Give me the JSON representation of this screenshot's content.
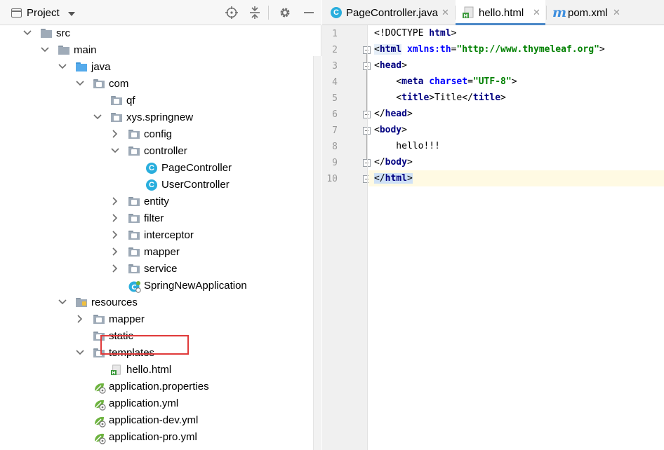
{
  "project_panel": {
    "title": "Project",
    "tree": [
      {
        "label": "src",
        "kind": "folder",
        "depth": 0,
        "state": "expanded"
      },
      {
        "label": "main",
        "kind": "folder",
        "depth": 1,
        "state": "expanded"
      },
      {
        "label": "java",
        "kind": "source-folder",
        "depth": 2,
        "state": "expanded"
      },
      {
        "label": "com",
        "kind": "package",
        "depth": 3,
        "state": "expanded"
      },
      {
        "label": "qf",
        "kind": "package",
        "depth": 4,
        "state": "none"
      },
      {
        "label": "xys.springnew",
        "kind": "package",
        "depth": 4,
        "state": "expanded"
      },
      {
        "label": "config",
        "kind": "package",
        "depth": 5,
        "state": "collapsed"
      },
      {
        "label": "controller",
        "kind": "package",
        "depth": 5,
        "state": "expanded"
      },
      {
        "label": "PageController",
        "kind": "class",
        "depth": 6,
        "state": "none"
      },
      {
        "label": "UserController",
        "kind": "class",
        "depth": 6,
        "state": "none"
      },
      {
        "label": "entity",
        "kind": "package",
        "depth": 5,
        "state": "collapsed"
      },
      {
        "label": "filter",
        "kind": "package",
        "depth": 5,
        "state": "collapsed"
      },
      {
        "label": "interceptor",
        "kind": "package",
        "depth": 5,
        "state": "collapsed"
      },
      {
        "label": "mapper",
        "kind": "package",
        "depth": 5,
        "state": "collapsed"
      },
      {
        "label": "service",
        "kind": "package",
        "depth": 5,
        "state": "collapsed"
      },
      {
        "label": "SpringNewApplication",
        "kind": "spring-class",
        "depth": 5,
        "state": "none"
      },
      {
        "label": "resources",
        "kind": "resource-folder",
        "depth": 2,
        "state": "expanded"
      },
      {
        "label": "mapper",
        "kind": "package",
        "depth": 3,
        "state": "collapsed"
      },
      {
        "label": "static",
        "kind": "package",
        "depth": 3,
        "state": "none"
      },
      {
        "label": "templates",
        "kind": "package",
        "depth": 3,
        "state": "expanded"
      },
      {
        "label": "hello.html",
        "kind": "html",
        "depth": 4,
        "state": "none",
        "highlighted": true
      },
      {
        "label": "application.properties",
        "kind": "spring-config",
        "depth": 3,
        "state": "none"
      },
      {
        "label": "application.yml",
        "kind": "spring-config",
        "depth": 3,
        "state": "none"
      },
      {
        "label": "application-dev.yml",
        "kind": "spring-config",
        "depth": 3,
        "state": "none"
      },
      {
        "label": "application-pro.yml",
        "kind": "spring-config",
        "depth": 3,
        "state": "none"
      }
    ]
  },
  "editor": {
    "tabs": [
      {
        "label": "PageController.java",
        "icon": "java-class-icon",
        "active": false
      },
      {
        "label": "hello.html",
        "icon": "html-file-icon",
        "active": true
      },
      {
        "label": "pom.xml",
        "icon": "maven-icon",
        "active": false
      }
    ],
    "line_numbers": [
      "1",
      "2",
      "3",
      "4",
      "5",
      "6",
      "7",
      "8",
      "9",
      "10"
    ],
    "current_line": "10"
  },
  "colors": {
    "tag": "#000080",
    "attribute": "#0000ff",
    "attribute_value": "#008000",
    "current_line_bg": "#fffae3",
    "highlight_box": "#e03a3a",
    "active_tab_underline": "#4a88c7"
  }
}
